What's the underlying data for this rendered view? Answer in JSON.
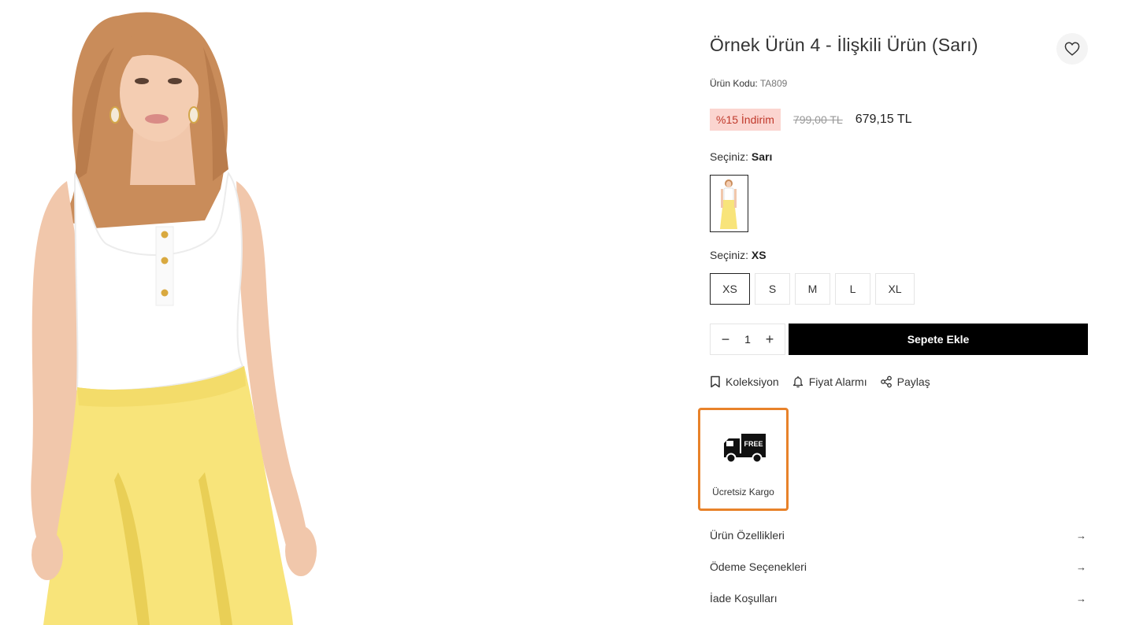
{
  "product": {
    "title": "Örnek Ürün 4 - İlişkili Ürün (Sarı)",
    "code_label": "Ürün Kodu:",
    "code_value": "TA809",
    "discount_badge": "%15 İndirim",
    "old_price": "799,00 TL",
    "new_price": "679,15 TL"
  },
  "color_selector": {
    "label": "Seçiniz:",
    "value": "Sarı"
  },
  "size_selector": {
    "label": "Seçiniz:",
    "value": "XS",
    "options": [
      "XS",
      "S",
      "M",
      "L",
      "XL"
    ]
  },
  "quantity": {
    "value": "1",
    "minus": "−",
    "plus": "+"
  },
  "cart": {
    "add_label": "Sepete Ekle"
  },
  "actions": {
    "collection": "Koleksiyon",
    "price_alarm": "Fiyat Alarmı",
    "share": "Paylaş"
  },
  "shipping": {
    "badge_text": "FREE",
    "label": "Ücretsiz Kargo"
  },
  "accordions": [
    {
      "label": "Ürün Özellikleri"
    },
    {
      "label": "Ödeme Seçenekleri"
    },
    {
      "label": "İade Koşulları"
    }
  ],
  "icons": {
    "favorite": "heart-icon",
    "collection": "bookmark-icon",
    "price_alarm": "bell-icon",
    "share": "share-icon",
    "shipping": "truck-icon",
    "accordion_arrow": "arrow-right-icon"
  },
  "colors": {
    "discount_bg": "#fbd5d0",
    "discount_text": "#c0392b",
    "cart_button": "#000000",
    "highlight_border": "#e8822a",
    "pants_yellow": "#f8e47a"
  }
}
